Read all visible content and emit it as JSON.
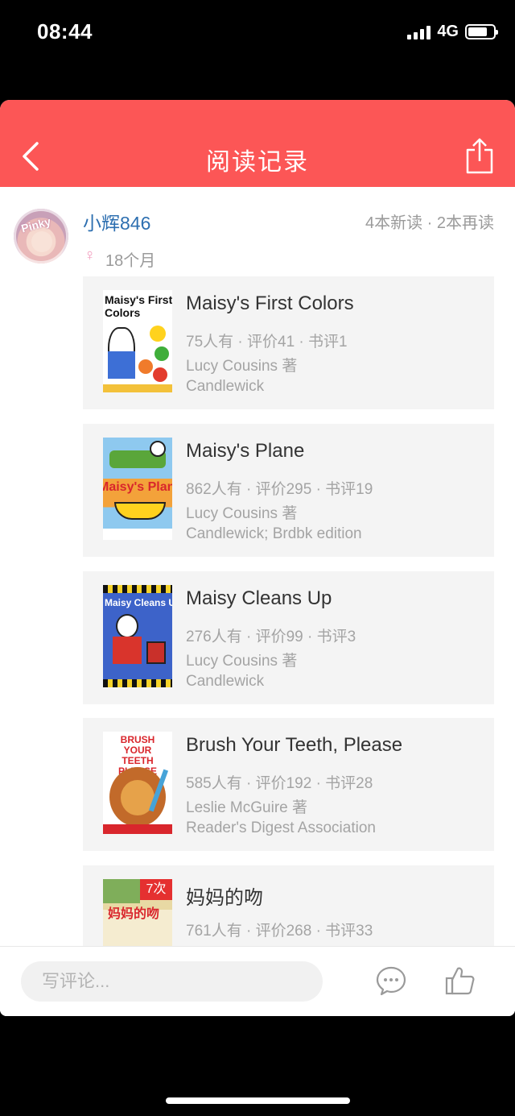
{
  "status_bar": {
    "time": "08:44",
    "network": "4G",
    "battery_level": 0.75
  },
  "header": {
    "title": "阅读记录",
    "back_icon": "chevron-left-icon",
    "share_icon": "share-icon"
  },
  "user": {
    "name": "小辉846",
    "avatar_text": "Pinky",
    "stats": "4本新读 · 2本再读",
    "gender_symbol": "♀",
    "age": "18个月"
  },
  "books": [
    {
      "title": "Maisy's First Colors",
      "meta": "75人有 · 评价41 · 书评1",
      "author": "Lucy Cousins 著",
      "publisher": "Candlewick",
      "cover_text": "Maisy's First Colors"
    },
    {
      "title": "Maisy's Plane",
      "meta": "862人有 · 评价295 · 书评19",
      "author": "Lucy Cousins 著",
      "publisher": "Candlewick; Brdbk edition",
      "cover_text": "Maisy's Plane"
    },
    {
      "title": "Maisy Cleans Up",
      "meta": "276人有 · 评价99 · 书评3",
      "author": "Lucy Cousins 著",
      "publisher": "Candlewick",
      "cover_text": "Maisy Cleans Up"
    },
    {
      "title": "Brush Your Teeth, Please",
      "meta": "585人有 · 评价192 · 书评28",
      "author": "Leslie McGuire 著",
      "publisher": "Reader's Digest Association",
      "cover_text": "BRUSH YOUR TEETH PLEASE"
    },
    {
      "title": "妈妈的吻",
      "meta": "761人有 · 评价268 · 书评33",
      "author": "",
      "publisher": "",
      "cover_text": "妈妈的吻",
      "badge": "7次"
    }
  ],
  "bottom_bar": {
    "comment_placeholder": "写评论...",
    "comment_icon": "comment-icon",
    "like_icon": "thumbs-up-icon"
  },
  "colors": {
    "header_red": "#fc5656",
    "username_blue": "#2d6fb0",
    "card_bg": "#f4f4f4",
    "meta_gray": "#a4a4a4"
  }
}
